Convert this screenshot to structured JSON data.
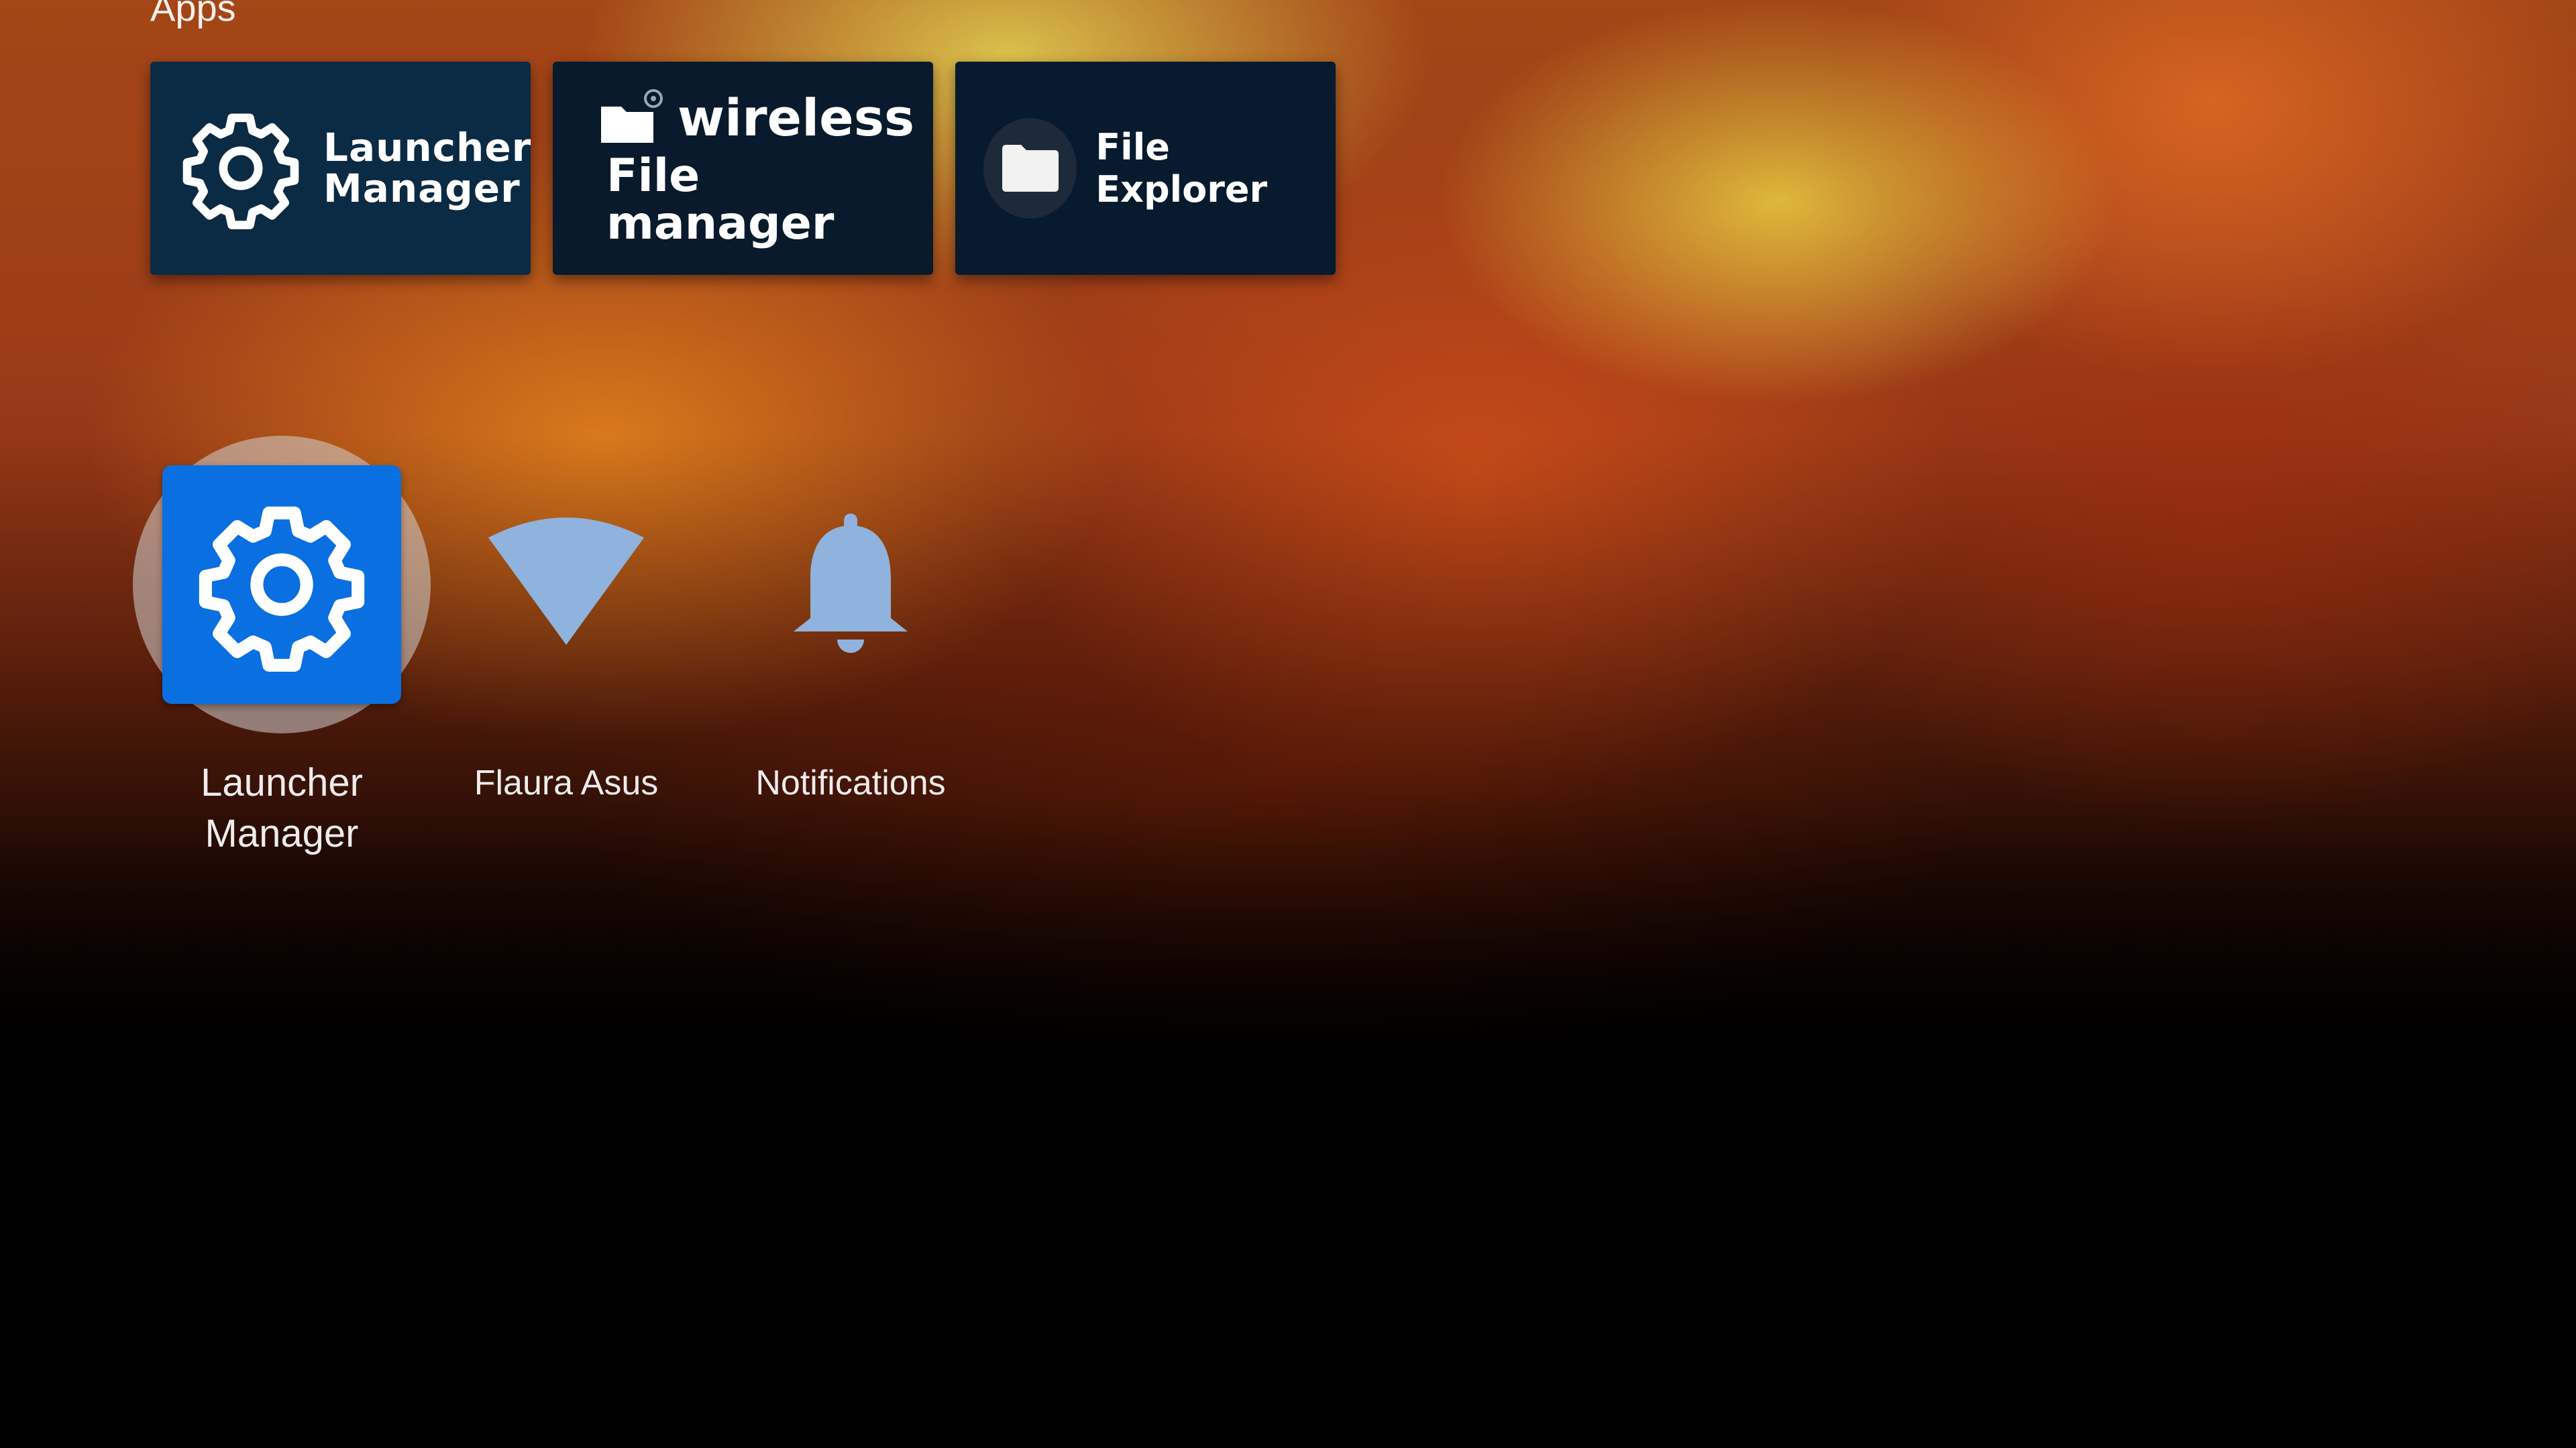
{
  "section": {
    "title": "Apps"
  },
  "banners": [
    {
      "id": "launcher-manager",
      "line1": "Launcher",
      "line2": "Manager"
    },
    {
      "id": "wireless-file-manager",
      "line1": "wireless",
      "line2": "File manager"
    },
    {
      "id": "file-explorer",
      "label": "File Explorer"
    }
  ],
  "apps": [
    {
      "name_line1": "Launcher",
      "name_line2": "Manager",
      "icon": "gear-icon",
      "focused": true
    },
    {
      "name": "Flaura Asus",
      "icon": "wifi-icon",
      "focused": false
    },
    {
      "name": "Notifications",
      "icon": "bell-icon",
      "focused": false
    }
  ],
  "colors": {
    "launcher_tile": "#0a6fe0",
    "banner_bg": "#061627",
    "icon_blue_grey": "#8fb3dc",
    "focus_ring": "#d2d2d2"
  }
}
